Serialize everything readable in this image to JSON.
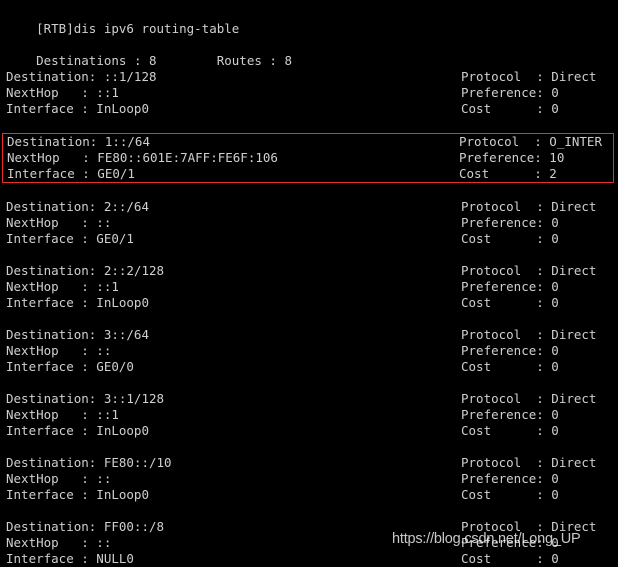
{
  "terminal": {
    "prompt_line": "[RTB]dis ipv6 routing-table",
    "summary": {
      "destinations_label": "Destinations :",
      "destinations_value": "8",
      "routes_label": "Routes :",
      "routes_value": "8",
      "full_line": "Destinations : 8        Routes : 8"
    },
    "colors": {
      "background": "#000000",
      "text": "#cfcfcf",
      "highlight_border": "#e62e2e"
    },
    "field_labels": {
      "destination": "Destination:",
      "nexthop": "NextHop   :",
      "interface": "Interface :",
      "protocol": "Protocol  :",
      "preference": "Preference:",
      "cost": "Cost      :"
    },
    "routes": [
      {
        "destination": "::1/128",
        "nexthop": "::1",
        "interface": "InLoop0",
        "protocol": "Direct",
        "preference": "0",
        "cost": "0",
        "highlighted": false
      },
      {
        "destination": "1::/64",
        "nexthop": "FE80::601E:7AFF:FE6F:106",
        "interface": "GE0/1",
        "protocol": "O_INTER",
        "preference": "10",
        "cost": "2",
        "highlighted": true
      },
      {
        "destination": "2::/64",
        "nexthop": "::",
        "interface": "GE0/1",
        "protocol": "Direct",
        "preference": "0",
        "cost": "0",
        "highlighted": false
      },
      {
        "destination": "2::2/128",
        "nexthop": "::1",
        "interface": "InLoop0",
        "protocol": "Direct",
        "preference": "0",
        "cost": "0",
        "highlighted": false
      },
      {
        "destination": "3::/64",
        "nexthop": "::",
        "interface": "GE0/0",
        "protocol": "Direct",
        "preference": "0",
        "cost": "0",
        "highlighted": false
      },
      {
        "destination": "3::1/128",
        "nexthop": "::1",
        "interface": "InLoop0",
        "protocol": "Direct",
        "preference": "0",
        "cost": "0",
        "highlighted": false
      },
      {
        "destination": "FE80::/10",
        "nexthop": "::",
        "interface": "InLoop0",
        "protocol": "Direct",
        "preference": "0",
        "cost": "0",
        "highlighted": false
      },
      {
        "destination": "FF00::/8",
        "nexthop": "::",
        "interface": "NULL0",
        "protocol": "Direct",
        "preference": "0",
        "cost": "0",
        "highlighted": false
      }
    ],
    "watermark": "https://blog.csdn.net/Long_UP"
  }
}
